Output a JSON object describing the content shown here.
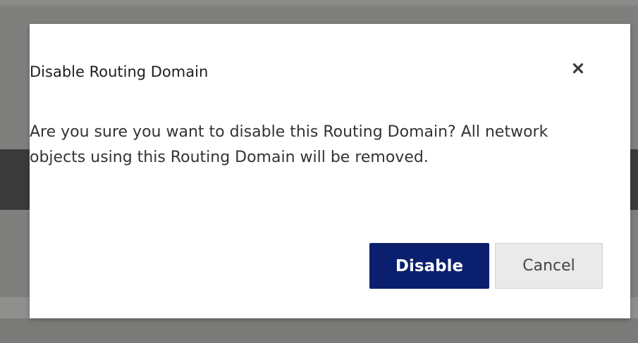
{
  "dialog": {
    "title": "Disable Routing Domain",
    "close_icon": "close-icon",
    "message": "Are you sure you want to disable this Routing Domain? All network objects using this Routing Domain will be removed.",
    "confirm_label": "Disable",
    "cancel_label": "Cancel"
  },
  "colors": {
    "overlay": "#7f7f7d",
    "background_band": "#3a3a3a",
    "dialog_background": "#ffffff",
    "primary_button": "#0a1f6d",
    "secondary_button": "#eaeaea",
    "title_text": "#1e1e1e",
    "body_text": "#333333"
  }
}
